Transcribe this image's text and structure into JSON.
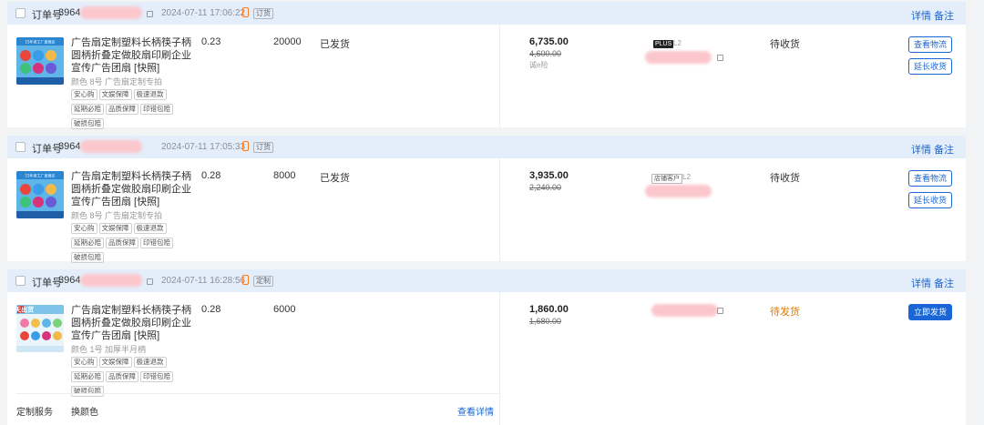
{
  "orders": [
    {
      "order_label": "订单号",
      "order_no_prefix": "3964",
      "time": "2024-07-11 17:06:22",
      "head_tag": "订货",
      "detail_link": "详情",
      "remark_link": "备注",
      "product_title": "广告扇定制塑料长柄筷子柄圆柄折叠定做胶扇印刷企业宣传广告团扇 [快照]",
      "spec": "颜色 8号 广告扇定制专拍",
      "tags": [
        "安心购",
        "文娱保障",
        "极速退款",
        "延期必赔",
        "品质保障",
        "印错包赔",
        "破损包赔"
      ],
      "unit_price": "0.23",
      "quantity": "20000",
      "item_status": "已发货",
      "total": "6,735.00",
      "original": "4,600.00",
      "total_note": "诚e险",
      "buyer_badge": "PLUS",
      "buyer_level": "L2",
      "order_status": "待收货",
      "buttons": [
        "查看物流",
        "延长收货"
      ]
    },
    {
      "order_label": "订单号",
      "order_no_prefix": "3964",
      "time": "2024-07-11 17:05:33",
      "head_tag": "订货",
      "detail_link": "详情",
      "remark_link": "备注",
      "product_title": "广告扇定制塑料长柄筷子柄圆柄折叠定做胶扇印刷企业宣传广告团扇 [快照]",
      "spec": "颜色 8号 广告扇定制专拍",
      "tags": [
        "安心购",
        "文娱保障",
        "极速退款",
        "延期必赔",
        "品质保障",
        "印错包赔",
        "破损包赔"
      ],
      "unit_price": "0.28",
      "quantity": "8000",
      "item_status": "已发货",
      "total": "3,935.00",
      "original": "2,240.00",
      "buyer_badge": "店铺客户",
      "buyer_level": "L2",
      "order_status": "待收货",
      "buttons": [
        "查看物流",
        "延长收货"
      ]
    },
    {
      "order_label": "订单号",
      "order_no_prefix": "3964",
      "time": "2024-07-11 16:28:56",
      "head_tag": "定制",
      "detail_link": "详情",
      "remark_link": "备注",
      "product_title": "广告扇定制塑料长柄筷子柄圆柄折叠定做胶扇印刷企业宣传广告团扇 [快照]",
      "spec": "颜色 1号 加厚半月柄",
      "tags": [
        "安心购",
        "文娱保障",
        "极速退款",
        "延期必赔",
        "品质保障",
        "印错包赔",
        "破损包赔"
      ],
      "unit_price": "0.28",
      "quantity": "6000",
      "total": "1,860.00",
      "original": "1,680.00",
      "order_status": "待发货",
      "buttons": [
        "立即发货"
      ],
      "service_label": "定制服务",
      "service_value": "换颜色",
      "service_link": "查看详情"
    }
  ],
  "thumb_text": {
    "a": "15年老工厂直营店",
    "b": "8 天出货"
  },
  "colors": {
    "accent": "#1a66d6",
    "header_bg": "#e4eefb",
    "pending": "#e07a00",
    "phone": "#ff7a1a"
  }
}
